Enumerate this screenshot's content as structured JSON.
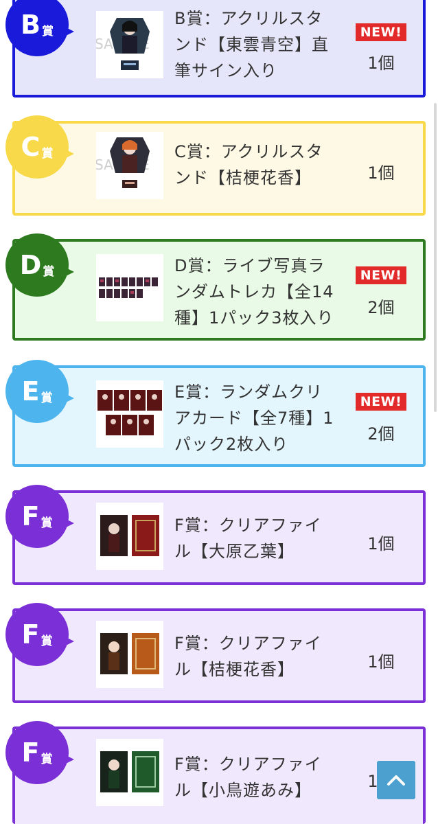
{
  "prizes": [
    {
      "rank": "B",
      "suffix": "賞",
      "title_lines": [
        "B賞：アクリルスタ",
        "ンド【東雲青空】直",
        "筆サイン入り"
      ],
      "new_label": "NEW!",
      "quantity": "1個",
      "color": "#1a1adb",
      "bg": "#e6e6fa"
    },
    {
      "rank": "C",
      "suffix": "賞",
      "title_lines": [
        "C賞：アクリルスタ",
        "ンド【桔梗花香】"
      ],
      "quantity": "1個",
      "color": "#f7d94a",
      "bg": "#fdf9e4"
    },
    {
      "rank": "D",
      "suffix": "賞",
      "title_lines": [
        "D賞：ライブ写真ラ",
        "ンダムトレカ【全14",
        "種】1パック3枚入り"
      ],
      "new_label": "NEW!",
      "quantity": "2個",
      "color": "#2d7a1f",
      "bg": "#e9fbe6"
    },
    {
      "rank": "E",
      "suffix": "賞",
      "title_lines": [
        "E賞：ランダムクリ",
        "アカード【全7種】1",
        "パック2枚入り"
      ],
      "new_label": "NEW!",
      "quantity": "2個",
      "color": "#4db4ee",
      "bg": "#e3f5fd"
    },
    {
      "rank": "F",
      "suffix": "賞",
      "title_lines": [
        "F賞：クリアファイ",
        "ル【大原乙葉】"
      ],
      "quantity": "1個",
      "color": "#7b2fd6",
      "bg": "#f0e8fc"
    },
    {
      "rank": "F",
      "suffix": "賞",
      "title_lines": [
        "F賞：クリアファイ",
        "ル【桔梗花香】"
      ],
      "quantity": "1個",
      "color": "#7b2fd6",
      "bg": "#f0e8fc"
    },
    {
      "rank": "F",
      "suffix": "賞",
      "title_lines": [
        "F賞：クリアファイ",
        "ル【小鳥遊あみ】"
      ],
      "quantity": "1個",
      "color": "#7b2fd6",
      "bg": "#f0e8fc"
    }
  ],
  "watermark": "SAMPLE",
  "back_to_top_icon": "chevron-up-icon"
}
